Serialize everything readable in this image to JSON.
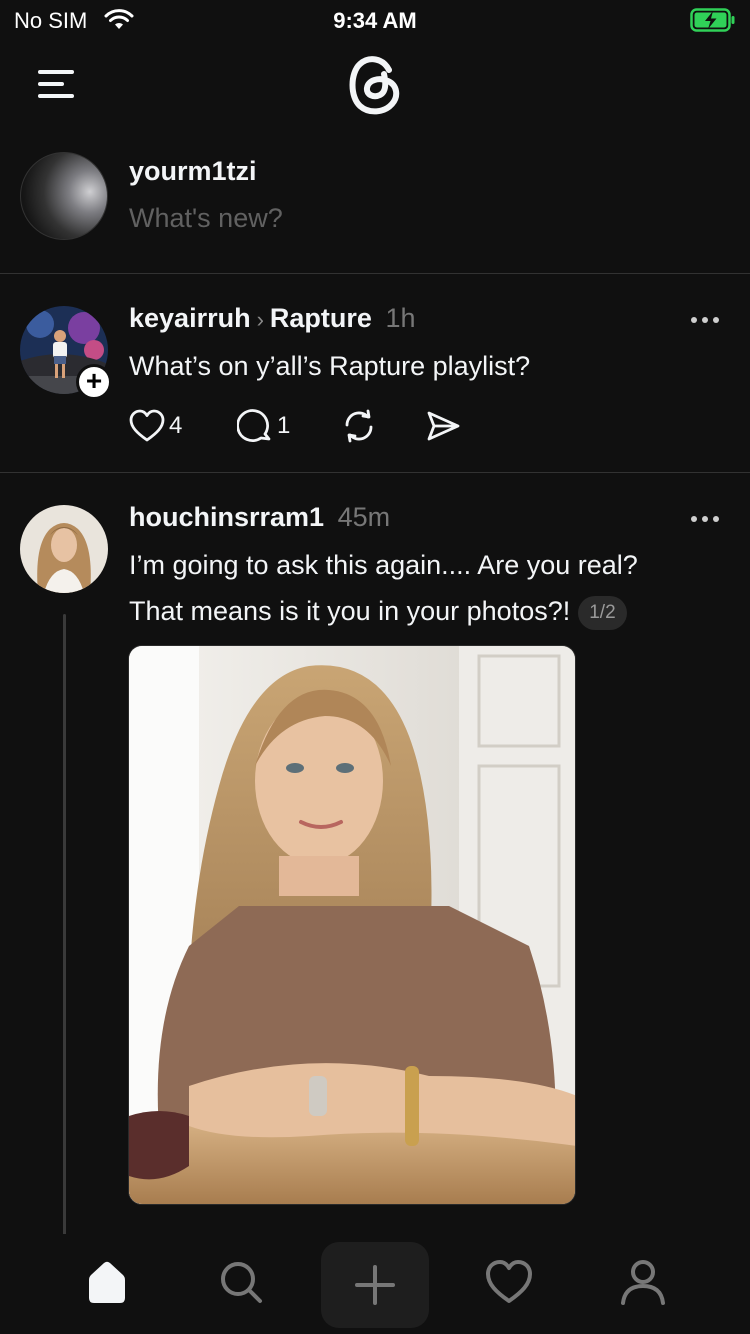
{
  "status_bar": {
    "carrier": "No SIM",
    "time": "9:34 AM",
    "battery_color": "#30d158"
  },
  "app": {
    "logo": "threads-logo-icon"
  },
  "composer": {
    "username": "yourm1tzi",
    "placeholder": "What's new?"
  },
  "posts": [
    {
      "username": "keyairruh",
      "community": "Rapture",
      "time": "1h",
      "text": "What’s on y’all’s Rapture playlist?",
      "likes": "4",
      "replies": "1"
    },
    {
      "username": "houchinsrram1",
      "time": "45m",
      "text_line1": "I’m going to ask this again.... Are you real?",
      "text_line2": "That means is it you in your photos?!",
      "pager": "1/2"
    }
  ],
  "colors": {
    "background": "#101010",
    "text": "#f3f5f7",
    "muted": "#777777",
    "divider": "#323232"
  },
  "nav": [
    "home-icon",
    "search-icon",
    "create-icon",
    "activity-heart-icon",
    "profile-icon"
  ]
}
